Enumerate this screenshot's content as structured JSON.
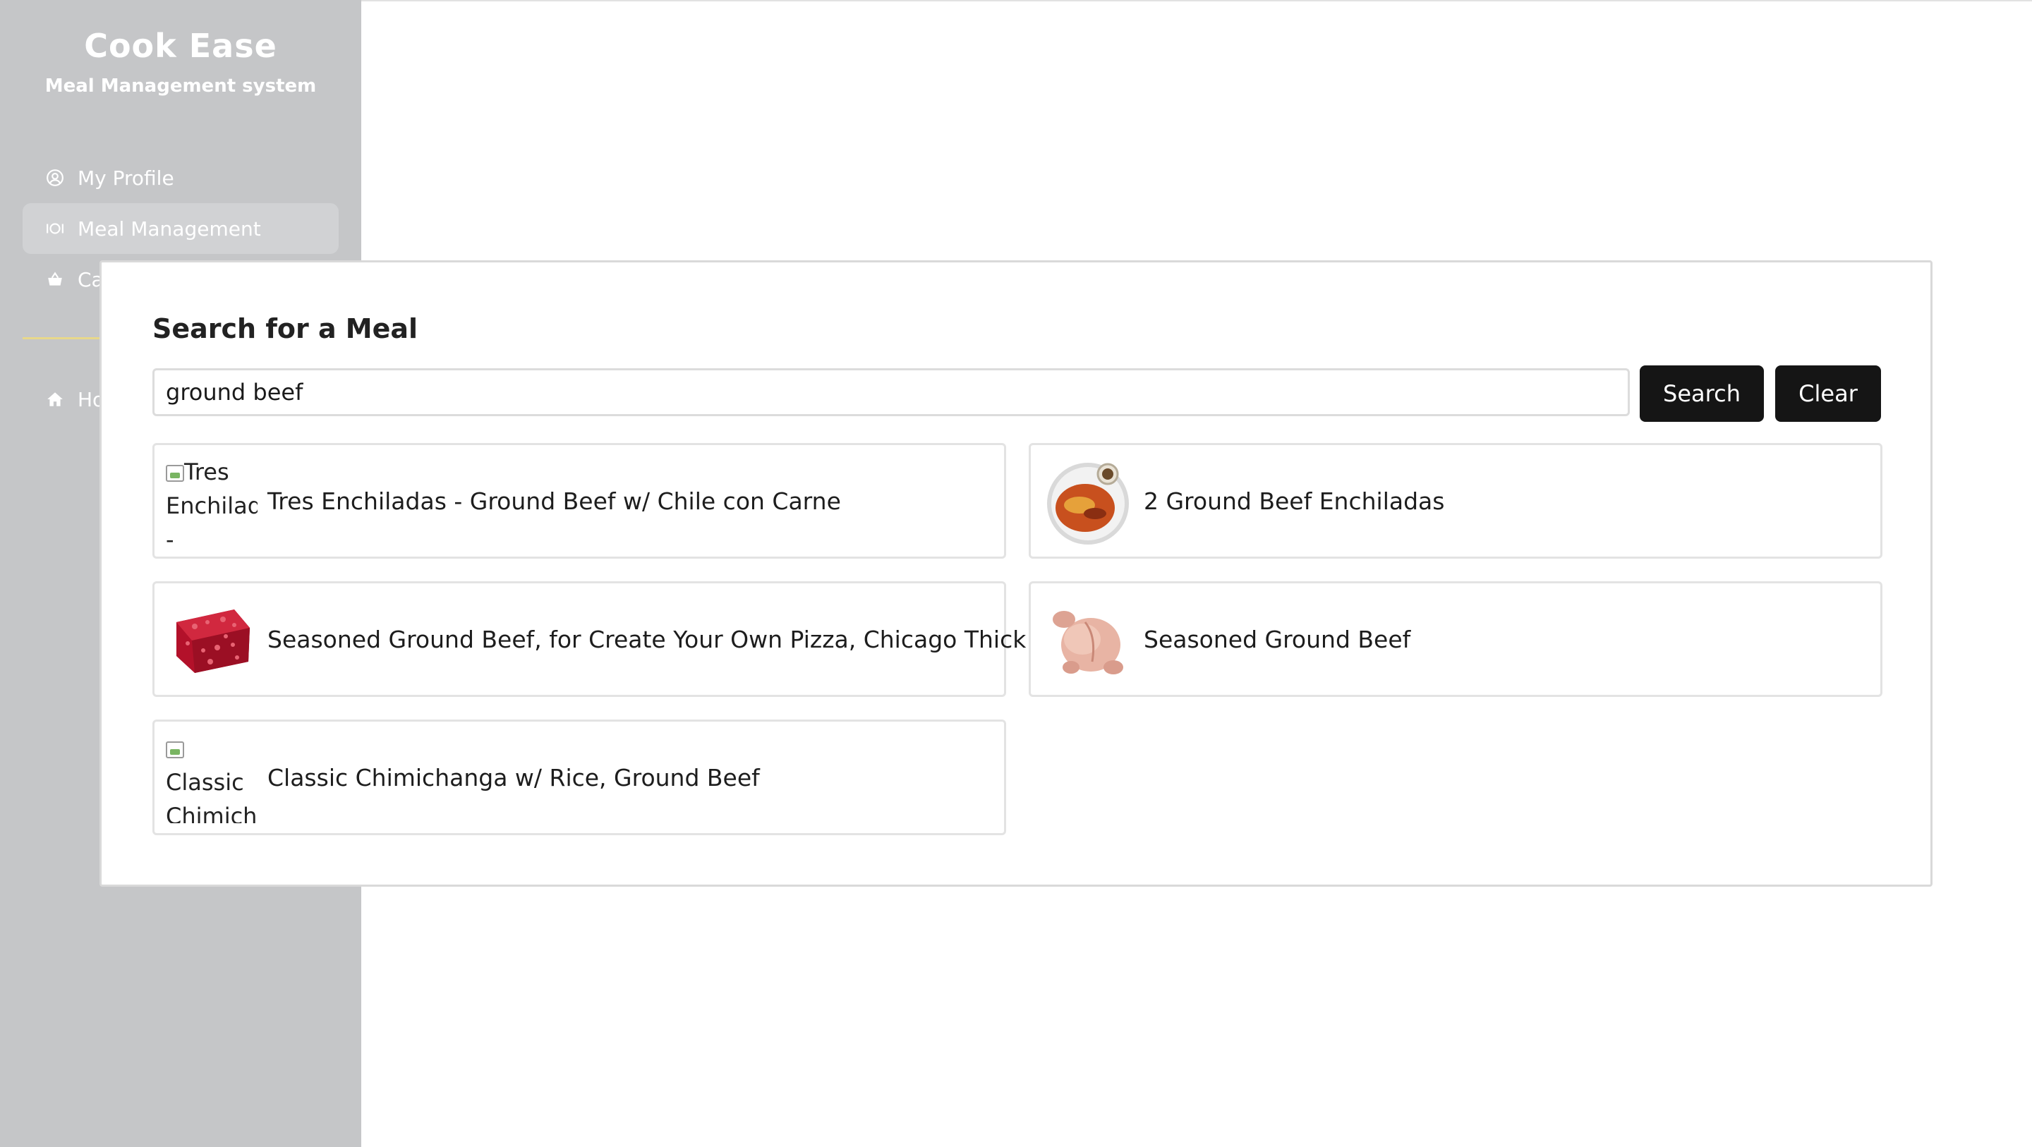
{
  "sidebar": {
    "brand_title": "Cook Ease",
    "brand_subtitle": "Meal Management system",
    "items": [
      {
        "label": "My Profile",
        "icon": "user-circle-icon"
      },
      {
        "label": "Meal Management",
        "icon": "plate-icon"
      },
      {
        "label": "Cart",
        "icon": "basket-icon"
      },
      {
        "label": "Home",
        "icon": "home-icon"
      }
    ]
  },
  "modal": {
    "title": "Search for a Meal",
    "search_value": "ground beef",
    "search_button": "Search",
    "clear_button": "Clear",
    "results": [
      {
        "name": "Tres Enchiladas - Ground Beef w/ Chile con Carne",
        "image_alt": "Tres Enchiladas -",
        "image": "broken"
      },
      {
        "name": "2 Ground Beef Enchiladas",
        "image": "enchiladas-plate"
      },
      {
        "name": "Seasoned Ground Beef, for Create Your Own Pizza, Chicago Thick",
        "image": "ground-beef"
      },
      {
        "name": "Seasoned Ground Beef",
        "image": "raw-chicken"
      },
      {
        "name": "Classic Chimichanga w/ Rice, Ground Beef",
        "image_alt": "Classic Chimichanga",
        "image": "broken"
      }
    ]
  },
  "colors": {
    "sidebar_bg": "#c5c6c8",
    "button_bg": "#151515",
    "accent_line": "#e8d88a"
  }
}
